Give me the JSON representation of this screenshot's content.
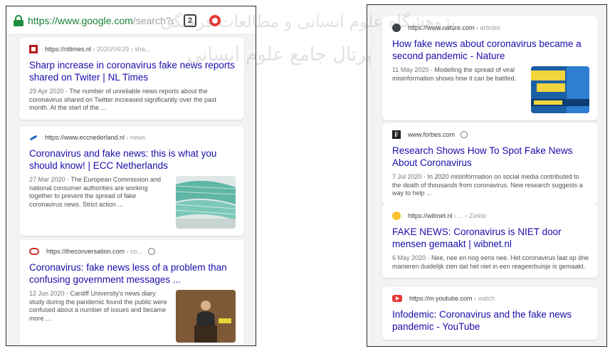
{
  "left_phone": {
    "url_host": "https://www.google.com",
    "url_path": "/search?clie",
    "tab_count": "2",
    "results": [
      {
        "source_url": "https://nltimes.nl",
        "source_path": " › 2020/04/29 › sha...",
        "title": "Sharp increase in coronavirus fake news reports shared on Twiter | NL Times",
        "date": "29 Apr 2020",
        "snippet": " · The number of unreliable news reports about the coronavirus shared on Twitter increased significantly over the past month. At the start of the ..."
      },
      {
        "source_url": "https://www.eccnederland.nl",
        "source_path": " › news",
        "title": "Coronavirus and fake news: this is what you should know! | ECC Netherlands",
        "date": "27 Mar 2020",
        "snippet": " · The European Commission and national consumer authorities are working together to prevent the spread of fake coronavirus news. Strict action ..."
      },
      {
        "source_url": "https://theconversation.com",
        "source_path": " › co...",
        "title": "Coronavirus: fake news less of a problem than confusing government messages ...",
        "date": "12 Jun 2020",
        "snippet": " · Cardiff University's news diary study during the pandemic found the public were confused about a number of issues and became more ..."
      }
    ]
  },
  "right_phone": {
    "results": [
      {
        "source_url": "https://www.nature.com",
        "source_path": " › articles",
        "title": "How fake news about coronavirus became a second pandemic - Nature",
        "date": "11 May 2020",
        "snippet": " · Modelling the spread of viral misinformation shows how it can be battled."
      },
      {
        "source_url": "www.forbes.com",
        "source_path": "",
        "title": "Research Shows How To Spot Fake News About Coronavirus",
        "date": "7 Jul 2020",
        "snippet": " · In 2020 misinformation on social media contributed to the death of thousands from coronavirus. New research suggests a way to help ..."
      },
      {
        "source_url": "https://wibnet.nl",
        "source_path": " › ... › Ziekte",
        "title": "FAKE NEWS: Coronavirus is NIET door mensen gemaakt | wibnet.nl",
        "date": "6 May 2020",
        "snippet": " · Nee, nee en nog eens nee. Het coronavirus laat op drie manieren duidelijk zien dat het niet in een reageerbuisje is gemaakt."
      },
      {
        "source_url": "https://m.youtube.com",
        "source_path": " › watch",
        "title": "Infodemic: Coronavirus and the fake news pandemic - YouTube"
      }
    ]
  },
  "watermark": {
    "line1": "پژوهشگاه علوم انسانی و مطالعات فرهنگی",
    "line2": "پرتال جامع علوم انسانی"
  },
  "colors": {
    "link": "#1a0dab",
    "url_green": "#188038",
    "secure_lock": "#1e8e3e",
    "snippet": "#4d5156",
    "page_background": "#f1f3f4"
  },
  "icons": [
    "lock-icon",
    "tab-switcher-icon",
    "opera-icon",
    "info-icon"
  ]
}
